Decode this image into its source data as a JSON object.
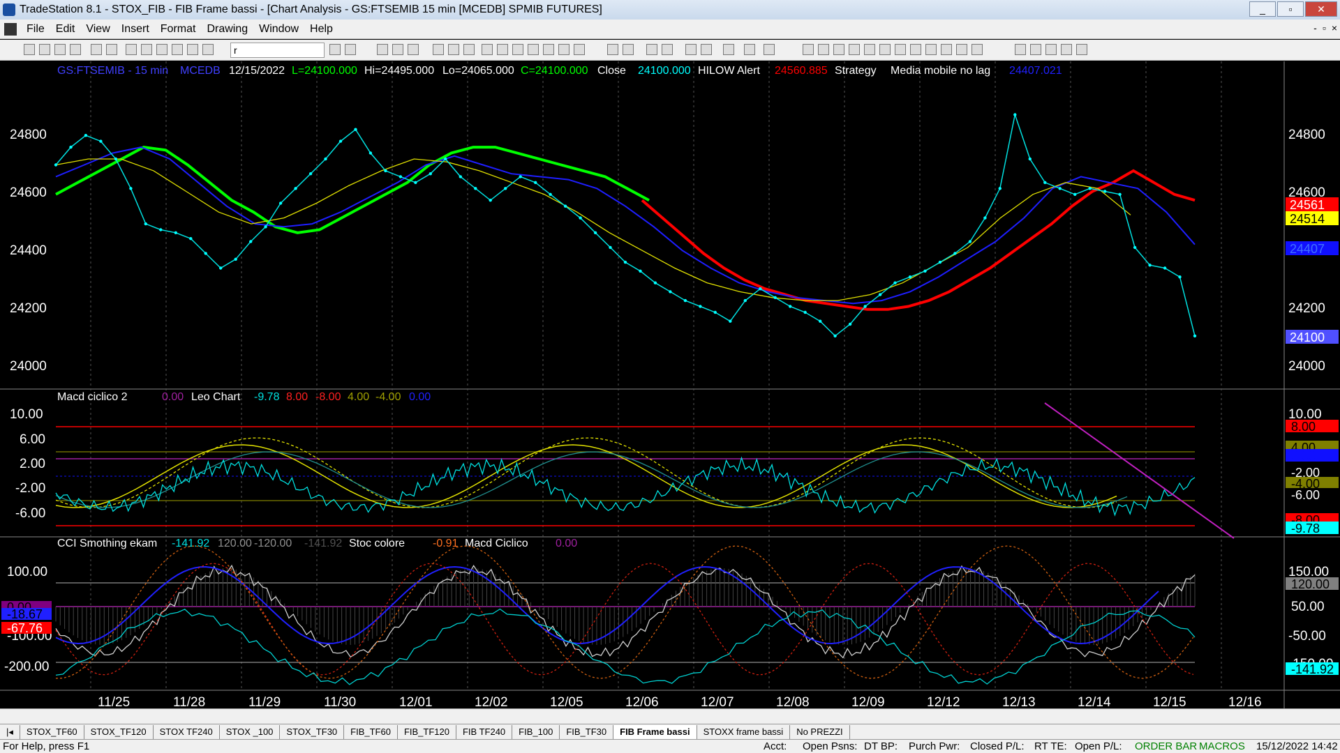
{
  "title": "TradeStation 8.1 - STOX_FIB - FIB Frame bassi - [Chart Analysis - GS:FTSEMIB 15 min  [MCEDB] SPMIB FUTURES]",
  "window_buttons": [
    "_",
    "▫",
    "✕"
  ],
  "menu": [
    "File",
    "Edit",
    "View",
    "Insert",
    "Format",
    "Drawing",
    "Window",
    "Help"
  ],
  "mdi_buttons": [
    "-",
    "▫",
    "×"
  ],
  "symbol_box": "r",
  "status_line": {
    "symbol": "GS:FTSEMIB - 15 min",
    "feed": "MCEDB",
    "date": "12/15/2022",
    "low": "L=24100.000",
    "high": "Hi=24495.000",
    "low2": "Lo=24065.000",
    "close": "C=24100.000",
    "close_label": "Close",
    "close_val": "24100.000",
    "ind1": "HILOW Alert",
    "ind1_val": "24560.885",
    "strategy": "Strategy",
    "ind2": "Media mobile no lag",
    "ind2_val": "24407.021"
  },
  "pane2_legend": {
    "name": "Macd ciclico 2",
    "v0": "0.00",
    "name2": "Leo Chart",
    "v1": "-9.78",
    "v2": "8.00",
    "v3": "-8.00",
    "v4": "4.00",
    "v5": "-4.00",
    "v6": "0.00"
  },
  "pane3_legend": {
    "name": "CCI Smothing ekam",
    "v1": "-141.92",
    "v2": "120.00",
    "v3": "-120.00",
    "v4": "-141.92",
    "name2": "Stoc colore",
    "v5": "-0.91",
    "name3": "Macd Ciclico",
    "v6": "0.00"
  },
  "price_axis": [
    "24800",
    "24600",
    "24400",
    "24200",
    "24000"
  ],
  "price_tags": [
    {
      "text": "24561",
      "bg": "#ff0000",
      "fg": "#ffffff"
    },
    {
      "text": "24514",
      "bg": "#ffff00",
      "fg": "#000000"
    },
    {
      "text": "24407",
      "bg": "#1010ff",
      "fg": "#3060ff"
    },
    {
      "text": "24100",
      "bg": "#5050ff",
      "fg": "#ffffff"
    }
  ],
  "macd_axis": [
    "10.00",
    "6.00",
    "2.00",
    "-2.00",
    "-6.00"
  ],
  "macd_tags": [
    {
      "text": "8.00",
      "bg": "#ff0000",
      "fg": "#000"
    },
    {
      "text": "4.00",
      "bg": "#808000",
      "fg": "#000"
    },
    {
      "text": "0.00",
      "bg": "#1010ff",
      "fg": "#1010ff"
    },
    {
      "text": "-2.00",
      "bg": "#000000",
      "fg": "#ffffff"
    },
    {
      "text": "-4.00",
      "bg": "#808000",
      "fg": "#000"
    },
    {
      "text": "-6.00",
      "bg": "#000000",
      "fg": "#ffffff"
    },
    {
      "text": "-8.00",
      "bg": "#ff0000",
      "fg": "#000"
    },
    {
      "text": "-9.78",
      "bg": "#00ffff",
      "fg": "#000"
    }
  ],
  "cci_axis": [
    "100.00",
    "-100.00",
    "-200.00"
  ],
  "cci_right_axis": [
    "150.00",
    "50.00",
    "-50.00",
    "-150.00"
  ],
  "cci_tags": [
    {
      "text": "120.00",
      "bg": "#808080",
      "fg": "#000"
    },
    {
      "text": "-141.92",
      "bg": "#00ffff",
      "fg": "#000"
    }
  ],
  "cci_left_tags": [
    {
      "text": "0.00",
      "bg": "#800080",
      "fg": "#000"
    },
    {
      "text": "-18.67",
      "bg": "#2020ff",
      "fg": "#000"
    },
    {
      "text": "-67.76",
      "bg": "#ff0000",
      "fg": "#fff"
    }
  ],
  "x_labels": [
    "11/25",
    "11/28",
    "11/29",
    "11/30",
    "12/01",
    "12/02",
    "12/05",
    "12/06",
    "12/07",
    "12/08",
    "12/09",
    "12/12",
    "12/13",
    "12/14",
    "12/15",
    "12/16"
  ],
  "tabs": [
    "STOX_TF60",
    "STOX_TF120",
    "STOX TF240",
    "STOX _100",
    "STOX_TF30",
    "FIB_TF60",
    "FIB_TF120",
    "FIB TF240",
    "FIB_100",
    "FIB_TF30",
    "FIB Frame bassi",
    "STOXX frame bassi",
    "No PREZZI"
  ],
  "active_tab": "FIB Frame bassi",
  "status_bar": {
    "help": "For Help, press F1",
    "acct": "Acct:",
    "open_psns": "Open Psns:",
    "dt_bp": "DT BP:",
    "purch": "Purch Pwr:",
    "closed_pl": "Closed P/L:",
    "rt_te": "RT TE:",
    "open_pl": "Open P/L:",
    "order_bar": "ORDER BAR",
    "macros": "MACROS",
    "datetime": "15/12/2022 14:42"
  },
  "chart_data": {
    "type": "line",
    "title": "GS:FTSEMIB - 15 min",
    "x_labels": [
      "11/25",
      "11/28",
      "11/29",
      "11/30",
      "12/01",
      "12/02",
      "12/05",
      "12/06",
      "12/07",
      "12/08",
      "12/09",
      "12/12",
      "12/13",
      "12/14",
      "12/15",
      "12/16"
    ],
    "ylim": [
      23920,
      24960
    ],
    "price_close_points": [
      24680,
      24740,
      24780,
      24760,
      24700,
      24600,
      24480,
      24460,
      24450,
      24430,
      24380,
      24330,
      24360,
      24420,
      24470,
      24550,
      24600,
      24650,
      24700,
      24760,
      24800,
      24720,
      24660,
      24640,
      24620,
      24650,
      24700,
      24640,
      24600,
      24560,
      24600,
      24640,
      24620,
      24580,
      24540,
      24500,
      24450,
      24400,
      24350,
      24320,
      24280,
      24250,
      24220,
      24200,
      24180,
      24150,
      24220,
      24260,
      24230,
      24200,
      24180,
      24150,
      24100,
      24140,
      24200,
      24240,
      24280,
      24300,
      24320,
      24350,
      24380,
      24420,
      24500,
      24600,
      24850,
      24700,
      24620,
      24600,
      24580,
      24600,
      24590,
      24580,
      24400,
      24340,
      24330,
      24300,
      24100
    ],
    "series_green_red_ma": [
      24580,
      24620,
      24660,
      24700,
      24740,
      24730,
      24680,
      24620,
      24560,
      24520,
      24470,
      24450,
      24460,
      24500,
      24540,
      24580,
      24620,
      24680,
      24720,
      24740,
      24740,
      24720,
      24700,
      24680,
      24660,
      24640,
      24600,
      24560,
      24500,
      24440,
      24380,
      24330,
      24290,
      24260,
      24240,
      24220,
      24210,
      24200,
      24190,
      24190,
      24200,
      24220,
      24250,
      24290,
      24330,
      24380,
      24430,
      24480,
      24540,
      24590,
      24620,
      24660,
      24620,
      24580,
      24560
    ],
    "series_blue_ma": [
      24640,
      24680,
      24720,
      24740,
      24700,
      24620,
      24540,
      24480,
      24470,
      24480,
      24520,
      24570,
      24620,
      24680,
      24710,
      24680,
      24650,
      24640,
      24630,
      24600,
      24540,
      24470,
      24390,
      24330,
      24280,
      24250,
      24230,
      24220,
      24210,
      24220,
      24250,
      24300,
      24360,
      24420,
      24500,
      24600,
      24640,
      24620,
      24600,
      24520,
      24410
    ],
    "series_yellow_ma": [
      24680,
      24700,
      24700,
      24660,
      24590,
      24520,
      24480,
      24500,
      24550,
      24610,
      24660,
      24700,
      24690,
      24660,
      24620,
      24580,
      24520,
      24450,
      24390,
      24330,
      24280,
      24250,
      24230,
      24220,
      24220,
      24240,
      24280,
      24340,
      24400,
      24500,
      24580,
      24620,
      24600,
      24510
    ]
  }
}
